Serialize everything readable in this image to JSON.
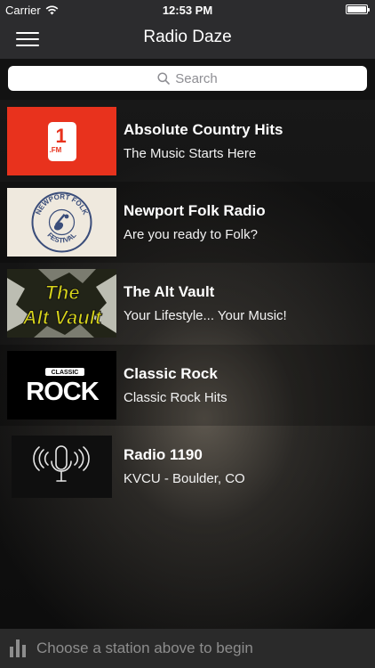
{
  "status_bar": {
    "carrier": "Carrier",
    "time": "12:53 PM",
    "icons": [
      "wifi-icon",
      "battery-icon"
    ]
  },
  "nav": {
    "title": "Radio Daze",
    "menu_icon": "hamburger-menu-icon"
  },
  "search": {
    "placeholder": "Search",
    "icon": "search-icon"
  },
  "stations": [
    {
      "name": "Absolute Country Hits",
      "description": "The Music Starts Here",
      "logo_text": "1",
      "logo_subtext": ".FM",
      "logo_color": "#e8321d"
    },
    {
      "name": "Newport Folk Radio",
      "description": "Are you ready to Folk?",
      "logo_text_top": "NEWPORT FOLK",
      "logo_text_bottom": "FESTIVAL",
      "logo_color": "#3a4d7a"
    },
    {
      "name": "The Alt Vault",
      "description": "Your Lifestyle... Your Music!",
      "logo_line1": "The",
      "logo_line2": "Alt Vault",
      "logo_color": "#d6d31a"
    },
    {
      "name": "Classic Rock",
      "description": "Classic Rock Hits",
      "logo_small": "CLASSIC",
      "logo_big": "ROCK"
    },
    {
      "name": "Radio 1190",
      "description": "KVCU - Boulder, CO",
      "logo_icon": "microphone-broadcast-icon"
    }
  ],
  "bottom_bar": {
    "message": "Choose a station above to begin",
    "icon": "equalizer-icon"
  }
}
